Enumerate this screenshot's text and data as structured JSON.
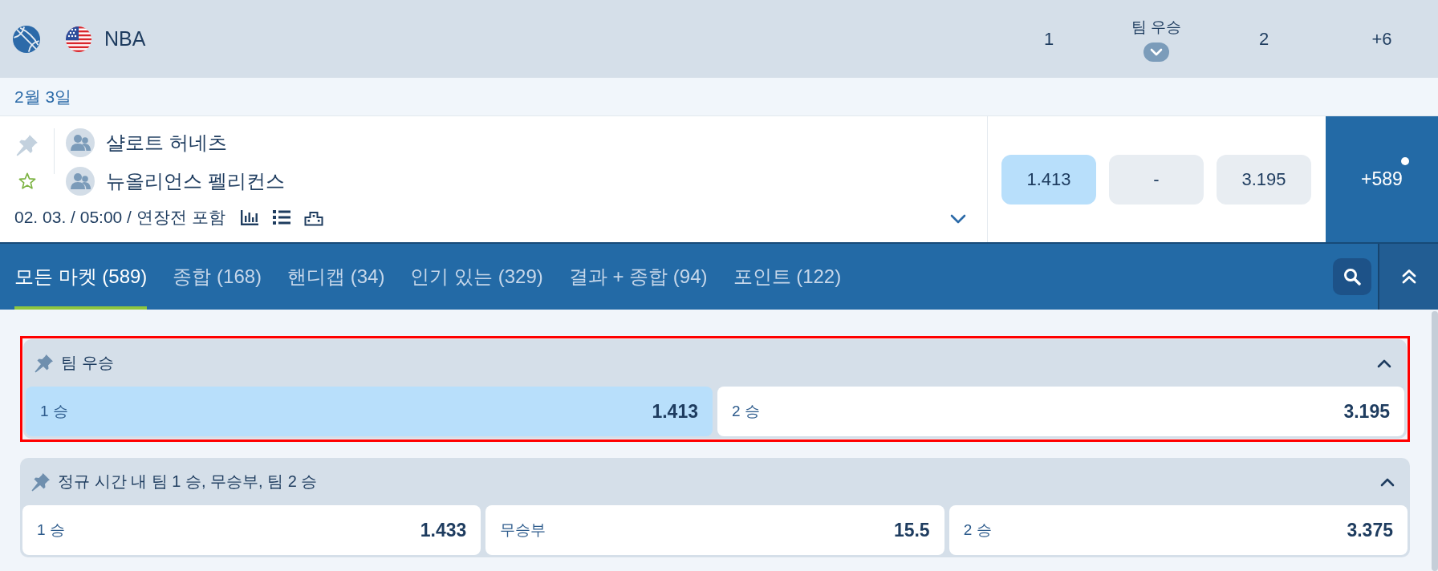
{
  "league": {
    "name": "NBA",
    "columns": [
      {
        "kind": "outcome",
        "label": "1"
      },
      {
        "kind": "market",
        "label": "팀 우승"
      },
      {
        "kind": "outcome",
        "label": "2"
      },
      {
        "kind": "more",
        "label": "+6"
      }
    ]
  },
  "date": "2월 3일",
  "match": {
    "pinned": false,
    "favorite": false,
    "teams": [
      {
        "name": "샬로트 허네츠"
      },
      {
        "name": "뉴올리언스 펠리컨스"
      }
    ],
    "info": "02. 03. / 05:00 / 연장전 포함",
    "odds": [
      {
        "value": "1.413",
        "selected": true
      },
      {
        "value": "-",
        "selected": false
      },
      {
        "value": "3.195",
        "selected": false
      }
    ],
    "more_markets": "+589"
  },
  "market_tabs": [
    {
      "label": "모든 마켓 (589)",
      "selected": true
    },
    {
      "label": "종합 (168)",
      "selected": false
    },
    {
      "label": "핸디캡 (34)",
      "selected": false
    },
    {
      "label": "인기 있는 (329)",
      "selected": false
    },
    {
      "label": "결과 + 종합 (94)",
      "selected": false
    },
    {
      "label": "포인트 (122)",
      "selected": false
    }
  ],
  "markets": [
    {
      "title": "팀 우승",
      "highlighted": true,
      "expanded": true,
      "outcomes": [
        {
          "label": "1 승",
          "odds": "1.413",
          "selected": true
        },
        {
          "label": "2 승",
          "odds": "3.195",
          "selected": false
        }
      ]
    },
    {
      "title": "정규 시간 내 팀 1 승, 무승부, 팀 2 승",
      "highlighted": false,
      "expanded": true,
      "outcomes": [
        {
          "label": "1 승",
          "odds": "1.433",
          "selected": false
        },
        {
          "label": "무승부",
          "odds": "15.5",
          "selected": false
        },
        {
          "label": "2 승",
          "odds": "3.375",
          "selected": false
        }
      ]
    }
  ]
}
